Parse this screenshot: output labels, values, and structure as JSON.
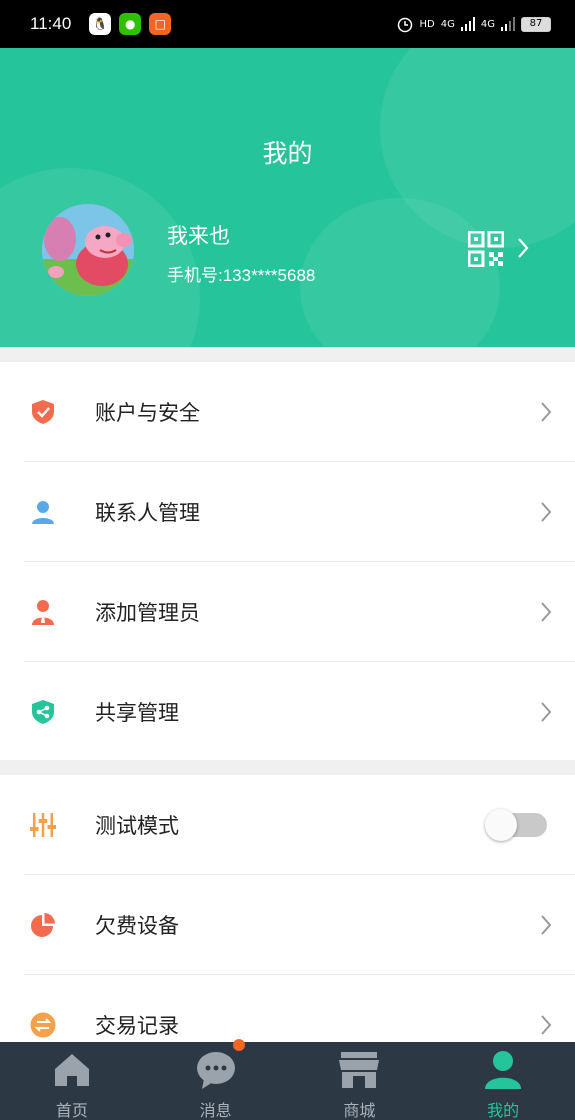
{
  "status_bar": {
    "time": "11:40",
    "network_1": "4G",
    "network_2": "4G",
    "hd": "HD",
    "battery": "87"
  },
  "header": {
    "title": "我的",
    "user_name": "我来也",
    "phone": "手机号:133****5688"
  },
  "menu_group_1": [
    {
      "label": "账户与安全",
      "icon": "shield-icon",
      "color": "#f26b4f"
    },
    {
      "label": "联系人管理",
      "icon": "person-icon",
      "color": "#5aa8e8"
    },
    {
      "label": "添加管理员",
      "icon": "admin-icon",
      "color": "#f26b4f"
    },
    {
      "label": "共享管理",
      "icon": "share-shield-icon",
      "color": "#26c49a"
    }
  ],
  "menu_group_2": [
    {
      "label": "测试模式",
      "icon": "sliders-icon",
      "color": "#f5a04b",
      "toggle": false
    },
    {
      "label": "欠费设备",
      "icon": "pie-chart-icon",
      "color": "#f26b4f"
    },
    {
      "label": "交易记录",
      "icon": "exchange-icon",
      "color": "#f5a04b"
    }
  ],
  "tabs": [
    {
      "label": "首页",
      "icon": "home-icon"
    },
    {
      "label": "消息",
      "icon": "message-icon"
    },
    {
      "label": "商城",
      "icon": "store-icon"
    },
    {
      "label": "我的",
      "icon": "user-icon",
      "active": true
    }
  ],
  "colors": {
    "accent": "#26c49a",
    "tabbar": "#2c3843",
    "badge": "#f26522"
  }
}
